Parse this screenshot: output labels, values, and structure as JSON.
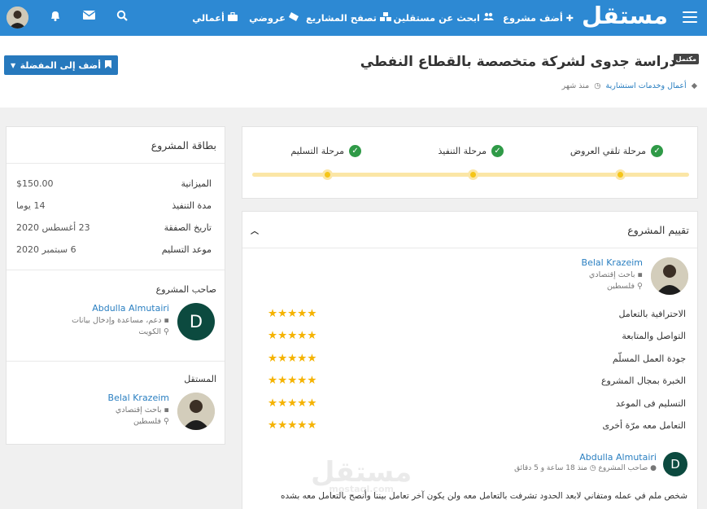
{
  "nav": {
    "logo": "مستقل",
    "items": [
      {
        "label": "أضف مشروع",
        "icon": "plus-icon"
      },
      {
        "label": "ابحث عن مستقلين",
        "icon": "users-icon"
      },
      {
        "label": "تصفح المشاريع",
        "icon": "cubes-icon"
      },
      {
        "label": "عروضي",
        "icon": "ticket-icon"
      },
      {
        "label": "أعمالي",
        "icon": "briefcase-icon"
      }
    ]
  },
  "project": {
    "badge": "مكتمل",
    "title": "دراسة جدوى لشركة متخصصة بالقطاع النفطي",
    "category": "أعمال وخدمات استشارية",
    "time": "منذ شهر",
    "favorite_label": "أضف إلى المفضلة"
  },
  "steps": [
    {
      "label": "مرحلة تلقي العروض"
    },
    {
      "label": "مرحلة التنفيذ"
    },
    {
      "label": "مرحلة التسليم"
    }
  ],
  "review": {
    "title": "تقييم المشروع",
    "reviewer": {
      "name": "Belal Krazeim",
      "role": "باحث إقتصادي",
      "country": "فلسطين"
    },
    "criteria": [
      {
        "label": "الاحترافية بالتعامل",
        "stars": 5
      },
      {
        "label": "التواصل والمتابعة",
        "stars": 5
      },
      {
        "label": "جودة العمل المسلّم",
        "stars": 5
      },
      {
        "label": "الخبرة بمجال المشروع",
        "stars": 5
      },
      {
        "label": "التسليم فى الموعد",
        "stars": 5
      },
      {
        "label": "التعامل معه مرّة أخرى",
        "stars": 5
      }
    ],
    "comment_author": {
      "initial": "D",
      "name": "Abdulla Almutairi",
      "role": "صاحب المشروع",
      "time": "منذ 18 ساعة و 5 دقائق"
    },
    "comment": "شخص ملم في عمله ومتفاني لابعد الحدود تشرفت بالتعامل معه ولن يكون آخر تعامل بيننا وأنصح بالتعامل معه بشده"
  },
  "card": {
    "title": "بطاقة المشروع",
    "rows": [
      {
        "label": "الميزانية",
        "value": "$150.00"
      },
      {
        "label": "مدة التنفيذ",
        "value": "14 يوما"
      },
      {
        "label": "تاريخ الصفقة",
        "value": "23 أغسطس 2020"
      },
      {
        "label": "موعد التسليم",
        "value": "6 سبتمبر 2020"
      }
    ],
    "owner_title": "صاحب المشروع",
    "owner": {
      "initial": "D",
      "name": "Abdulla Almutairi",
      "role": "دعم، مساعدة وإدخال بيانات",
      "country": "الكويت"
    },
    "freelancer_title": "المستقل",
    "freelancer": {
      "name": "Belal Krazeim",
      "role": "باحث إقتصادي",
      "country": "فلسطين"
    }
  },
  "watermark": {
    "text": "مستقل",
    "domain": "mostaql.com"
  },
  "colors": {
    "nav": "#2d89d3",
    "accent": "#2a7fc1",
    "success": "#2f9a47",
    "star": "#f5b301",
    "track": "#fbe6a6"
  }
}
